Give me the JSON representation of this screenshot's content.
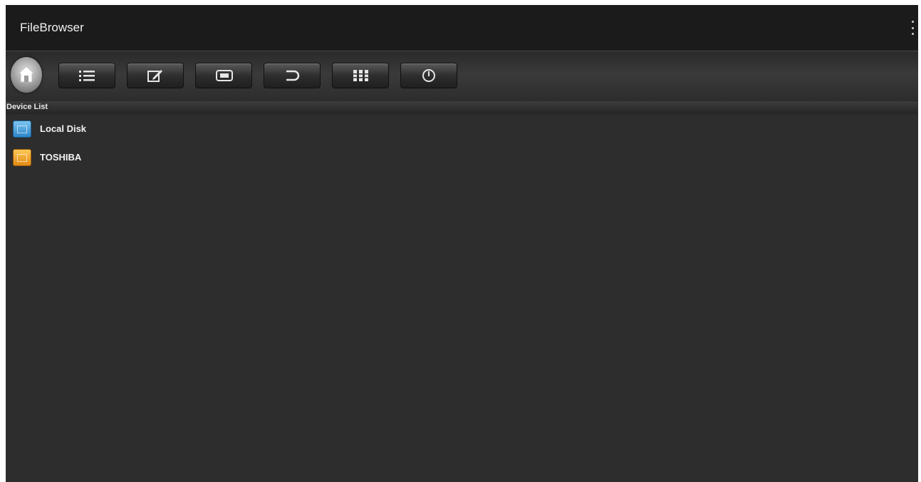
{
  "app": {
    "title": "FileBrowser"
  },
  "toolbar": {
    "buttons": [
      {
        "icon": "home-icon"
      },
      {
        "icon": "list-icon"
      },
      {
        "icon": "edit-icon"
      },
      {
        "icon": "screen-icon"
      },
      {
        "icon": "undo-icon"
      },
      {
        "icon": "grid-icon"
      },
      {
        "icon": "power-icon"
      }
    ]
  },
  "section": {
    "label": "Device List"
  },
  "devices": [
    {
      "label": "Local Disk",
      "icon": "local-disk-icon",
      "color": "#2d86c9"
    },
    {
      "label": "TOSHIBA",
      "icon": "usb-drive-icon",
      "color": "#e08a12"
    }
  ]
}
